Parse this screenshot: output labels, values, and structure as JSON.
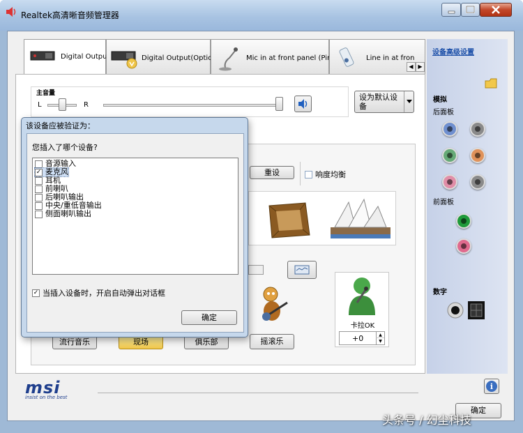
{
  "window": {
    "title": "Realtek高清晰音频管理器"
  },
  "tabs": [
    {
      "label": "Digital Output",
      "active": true
    },
    {
      "label": "Digital Output(Optical)",
      "active": false
    },
    {
      "label": "Mic in at front panel (Pink)",
      "active": false
    },
    {
      "label": "Line in at fron",
      "active": false
    }
  ],
  "main": {
    "volume_label": "主音量",
    "left_label": "L",
    "right_label": "R",
    "default_device_button": "设为默认设备",
    "reset_button": "重设",
    "loudness_label": "响度均衡",
    "karaoke_label": "卡拉OK",
    "karaoke_value": "+0",
    "presets": [
      "流行音乐",
      "现场",
      "俱乐部",
      "摇滚乐"
    ]
  },
  "sidebar": {
    "advanced_link": "设备高级设置",
    "analog_heading": "模拟",
    "back_panel": "后面板",
    "front_panel": "前面板",
    "digital_heading": "数字"
  },
  "dialog": {
    "title": "该设备应被验证为：",
    "question": "您插入了哪个设备?",
    "devices": [
      {
        "label": "音源输入",
        "checked": false
      },
      {
        "label": "麦克风",
        "checked": true
      },
      {
        "label": "耳机",
        "checked": false
      },
      {
        "label": "前喇叭",
        "checked": false
      },
      {
        "label": "后喇叭输出",
        "checked": false
      },
      {
        "label": "中央/重低音输出",
        "checked": false
      },
      {
        "label": "侧面喇叭输出",
        "checked": false
      }
    ],
    "auto_popup_label": "当插入设备时，开启自动弹出对话框",
    "auto_popup_checked": true,
    "ok_button": "确定"
  },
  "footer": {
    "brand": "msi",
    "tagline": "insist on the best",
    "ok_button": "确定",
    "info_icon": "i"
  },
  "watermark": "头条号 / 幻尘科技",
  "colors": {
    "accent_link": "#1a4ea8",
    "preset_active": "#f0c64a",
    "jack_blue": "#6f8fcf",
    "jack_green": "#66aa77",
    "jack_orange": "#e0925a",
    "jack_pink": "#e18ea8",
    "jack_gray": "#8a8a8a",
    "karaoke_green": "#4aa84a"
  }
}
